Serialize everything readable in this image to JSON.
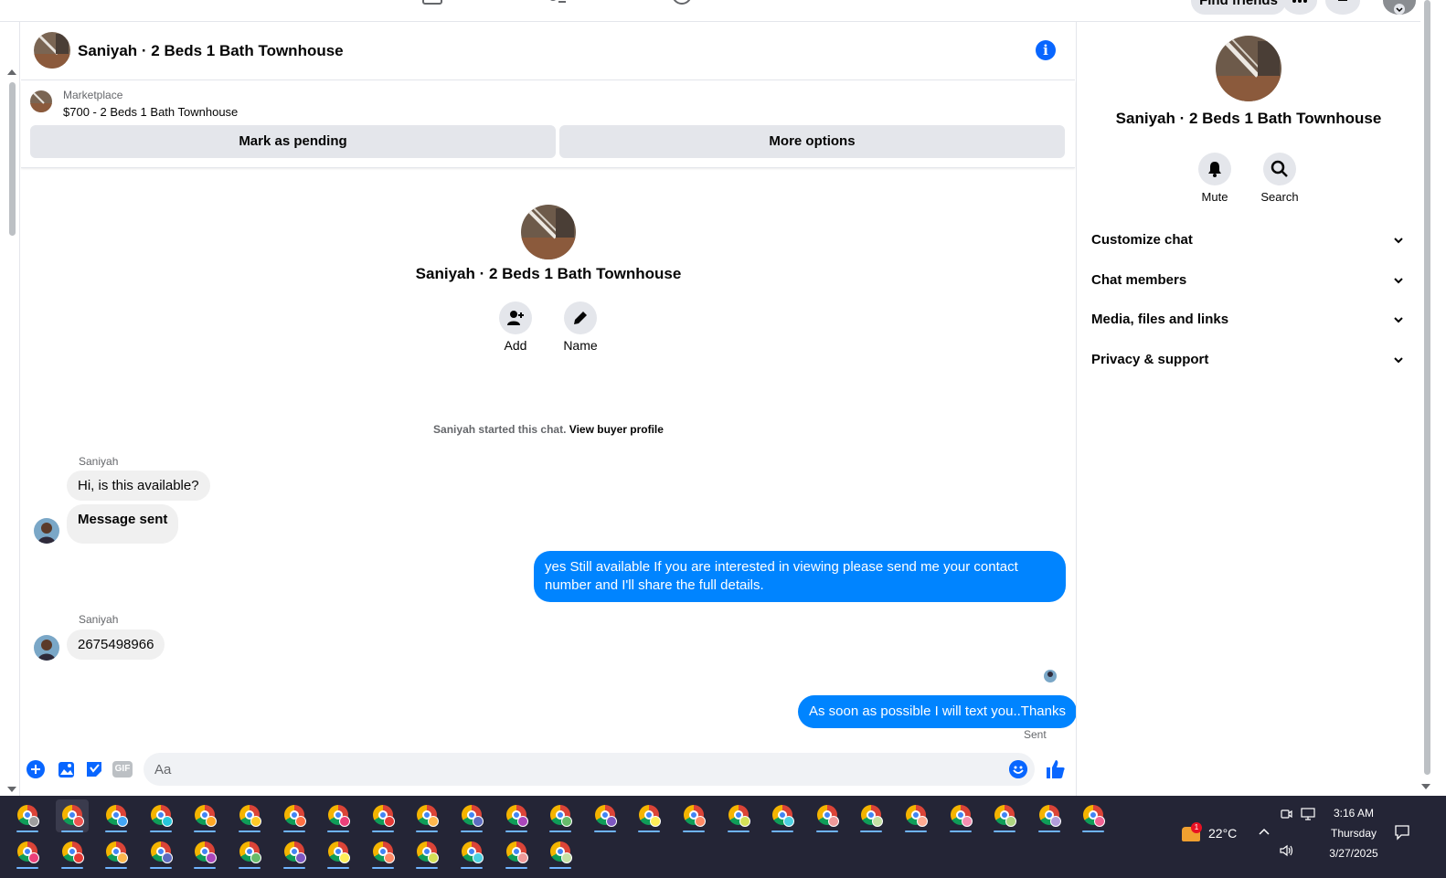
{
  "topnav": {
    "find_friends": "Find friends"
  },
  "header": {
    "title": "Saniyah · 2 Beds 1 Bath Townhouse"
  },
  "marketplace": {
    "label": "Marketplace",
    "listing": "$700 - 2 Beds 1 Bath Townhouse",
    "mark_pending": "Mark as pending",
    "more_options": "More options"
  },
  "intro": {
    "title": "Saniyah · 2 Beds 1 Bath Townhouse",
    "add_label": "Add",
    "name_label": "Name",
    "started_text": "Saniyah started this chat.",
    "view_buyer_profile": "View buyer profile"
  },
  "messages": [
    {
      "sender": "Saniyah",
      "text": "Hi, is this available?"
    },
    {
      "text": "Message sent"
    },
    {
      "text": "yes Still available If you are interested in viewing please send me your contact number and I'll share the full details."
    },
    {
      "sender": "Saniyah",
      "text": "2675498966"
    },
    {
      "text": "As soon as possible I will text you..Thanks"
    }
  ],
  "status": {
    "sent": "Sent"
  },
  "composer": {
    "placeholder": "Aa",
    "gif_label": "GIF"
  },
  "right_panel": {
    "title": "Saniyah · 2 Beds 1 Bath Townhouse",
    "mute": "Mute",
    "search": "Search",
    "sections": [
      "Customize chat",
      "Chat members",
      "Media, files and links",
      "Privacy & support"
    ]
  },
  "taskbar": {
    "temperature": "22°C",
    "weather_badge": "1",
    "time": "3:16 AM",
    "day": "Thursday",
    "date": "3/27/2025"
  },
  "colors": {
    "accent": "#0866ff",
    "bubble_out": "#0084ff",
    "bubble_in": "#f0f0f0",
    "taskbar": "#242536"
  }
}
